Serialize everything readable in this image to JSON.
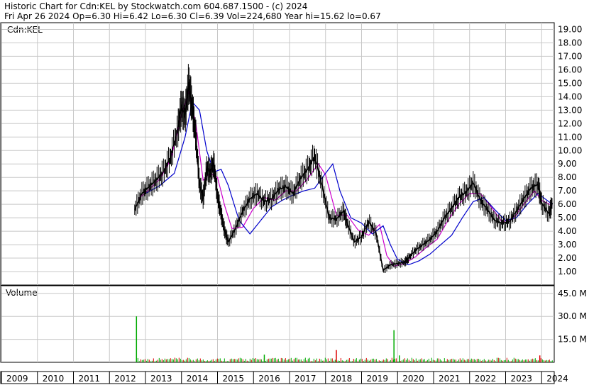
{
  "header": {
    "line1": "Historic Chart for Cdn:KEL by Stockwatch.com 604.687.1500 - (c) 2024",
    "line2": "Fri Apr 26 2024   Op=6.30   Hi=6.42   Lo=6.30   Cl=6.39   Vol=224,680   Year hi=15.62   lo=0.67"
  },
  "colors": {
    "price": "#000000",
    "ma_fast": "#cc00cc",
    "ma_slow": "#0000cc",
    "vol_up": "#00aa00",
    "vol_down": "#dd0000",
    "grid": "#c8c8c8"
  },
  "chart_data": [
    {
      "type": "line",
      "label": "Cdn:KEL",
      "x_unit": "year",
      "ylim": [
        0,
        19.5
      ],
      "y_ticks": [
        "19.00",
        "18.00",
        "17.00",
        "16.00",
        "15.00",
        "14.00",
        "13.00",
        "12.00",
        "11.00",
        "10.00",
        "9.00",
        "8.00",
        "7.00",
        "6.00",
        "5.00",
        "4.00",
        "3.00",
        "2.00",
        "1.00"
      ],
      "grid": true,
      "series": [
        {
          "color": "#000000",
          "x": [
            2012.7,
            2012.9,
            2013.1,
            2013.3,
            2013.5,
            2013.7,
            2013.9,
            2014.0,
            2014.1,
            2014.2,
            2014.3,
            2014.4,
            2014.5,
            2014.6,
            2014.7,
            2014.8,
            2014.9,
            2015.0,
            2015.1,
            2015.2,
            2015.3,
            2015.5,
            2015.7,
            2015.9,
            2016.1,
            2016.3,
            2016.5,
            2016.7,
            2016.9,
            2017.1,
            2017.3,
            2017.5,
            2017.7,
            2017.9,
            2018.1,
            2018.3,
            2018.5,
            2018.6,
            2018.8,
            2019.0,
            2019.2,
            2019.4,
            2019.6,
            2019.8,
            2020.0,
            2020.2,
            2020.3,
            2020.5,
            2020.7,
            2020.9,
            2021.1,
            2021.3,
            2021.5,
            2021.7,
            2021.9,
            2022.1,
            2022.3,
            2022.5,
            2022.7,
            2022.9,
            2023.1,
            2023.3,
            2023.5,
            2023.7,
            2023.9,
            2024.0,
            2024.2,
            2024.3
          ],
          "y": [
            5.6,
            6.8,
            7.3,
            7.8,
            8.4,
            9.5,
            11.6,
            13.3,
            12.6,
            15.0,
            13.2,
            11.0,
            7.5,
            6.4,
            8.6,
            8.4,
            9.0,
            6.6,
            5.3,
            4.0,
            3.2,
            4.2,
            5.5,
            6.4,
            6.8,
            6.2,
            6.4,
            7.1,
            7.3,
            6.8,
            7.9,
            8.6,
            9.6,
            7.4,
            5.0,
            4.9,
            5.5,
            4.6,
            3.2,
            3.6,
            4.7,
            3.9,
            1.1,
            1.5,
            1.6,
            1.7,
            2.0,
            2.6,
            3.0,
            3.4,
            4.0,
            5.0,
            5.7,
            6.5,
            6.9,
            7.6,
            6.3,
            5.6,
            4.8,
            4.6,
            4.7,
            5.5,
            6.4,
            7.2,
            7.5,
            6.1,
            5.3,
            6.1
          ]
        },
        {
          "color": "#cc00cc",
          "x": [
            2012.8,
            2013.1,
            2013.4,
            2013.7,
            2014.0,
            2014.2,
            2014.4,
            2014.6,
            2014.8,
            2015.0,
            2015.2,
            2015.4,
            2015.7,
            2016.0,
            2016.3,
            2016.6,
            2016.9,
            2017.2,
            2017.5,
            2017.8,
            2018.0,
            2018.3,
            2018.6,
            2018.9,
            2019.2,
            2019.5,
            2019.7,
            2019.9,
            2020.2,
            2020.5,
            2020.8,
            2021.1,
            2021.4,
            2021.7,
            2022.0,
            2022.3,
            2022.6,
            2022.9,
            2023.2,
            2023.5,
            2023.8,
            2024.0,
            2024.3
          ],
          "y": [
            6.4,
            7.1,
            7.9,
            9.3,
            12.6,
            14.4,
            12.0,
            7.8,
            8.3,
            8.0,
            5.9,
            4.2,
            4.3,
            5.7,
            6.5,
            6.3,
            7.0,
            7.0,
            7.9,
            9.0,
            8.2,
            5.2,
            5.2,
            4.1,
            3.7,
            4.5,
            2.2,
            1.4,
            1.6,
            2.1,
            2.8,
            3.4,
            4.8,
            6.0,
            6.8,
            6.8,
            5.8,
            4.7,
            4.9,
            6.0,
            7.0,
            6.3,
            5.9
          ]
        },
        {
          "color": "#0000cc",
          "x": [
            2013.0,
            2013.4,
            2013.8,
            2014.1,
            2014.3,
            2014.5,
            2014.7,
            2014.9,
            2015.1,
            2015.3,
            2015.6,
            2015.9,
            2016.2,
            2016.5,
            2016.8,
            2017.1,
            2017.4,
            2017.7,
            2018.0,
            2018.2,
            2018.4,
            2018.7,
            2019.0,
            2019.3,
            2019.6,
            2019.8,
            2020.0,
            2020.3,
            2020.6,
            2020.9,
            2021.2,
            2021.5,
            2021.8,
            2022.1,
            2022.4,
            2022.7,
            2023.0,
            2023.3,
            2023.6,
            2023.9,
            2024.1,
            2024.3
          ],
          "y": [
            6.8,
            7.4,
            8.3,
            11.0,
            13.6,
            13.0,
            10.0,
            8.4,
            8.6,
            7.4,
            4.8,
            3.8,
            4.8,
            5.8,
            6.3,
            6.7,
            7.0,
            7.2,
            8.3,
            9.0,
            7.0,
            5.0,
            4.6,
            3.8,
            4.4,
            3.0,
            1.9,
            1.5,
            1.8,
            2.3,
            3.0,
            3.7,
            5.0,
            6.2,
            6.5,
            5.6,
            4.8,
            5.0,
            6.0,
            6.8,
            6.4,
            6.0
          ]
        }
      ]
    },
    {
      "type": "bar",
      "label": "Volume",
      "x_unit": "year",
      "ylim": [
        0,
        50
      ],
      "y_unit": "millions",
      "y_ticks": [
        "45.0 M",
        "30.0 M",
        "15.0 M"
      ],
      "spikes": [
        {
          "x": 2012.75,
          "value": 30.0,
          "color": "#00aa00"
        },
        {
          "x": 2018.3,
          "value": 8.0,
          "color": "#dd0000"
        },
        {
          "x": 2019.9,
          "value": 21.0,
          "color": "#00aa00"
        },
        {
          "x": 2020.05,
          "value": 4.5,
          "color": "#00aa00"
        },
        {
          "x": 2016.3,
          "value": 5.0,
          "color": "#00aa00"
        },
        {
          "x": 2023.95,
          "value": 4.5,
          "color": "#dd0000"
        }
      ],
      "baseline_level": 1.5
    }
  ],
  "x_axis": {
    "years": [
      "2009",
      "2010",
      "2011",
      "2012",
      "2013",
      "2014",
      "2015",
      "2016",
      "2017",
      "2018",
      "2019",
      "2020",
      "2021",
      "2022",
      "2023",
      "2024"
    ],
    "start": 2009.0,
    "end": 2024.35
  }
}
